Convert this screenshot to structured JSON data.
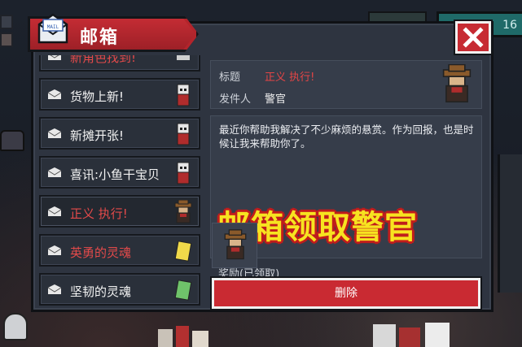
{
  "background": {
    "counter_text": "16"
  },
  "dialog": {
    "title": "邮箱",
    "mail_icon_text": "MAIL",
    "close_icon": "close-icon",
    "accent_color": "#c72b33"
  },
  "mail_list": {
    "items": [
      {
        "label": "新角色找到!",
        "color": "red",
        "thumb": "raccoon-icon"
      },
      {
        "label": "货物上新!",
        "color": "white",
        "thumb": "cat-merchant-icon"
      },
      {
        "label": "新摊开张!",
        "color": "white",
        "thumb": "cat-merchant-icon"
      },
      {
        "label": "喜讯:小鱼干宝贝",
        "color": "white",
        "thumb": "cat-merchant-icon"
      },
      {
        "label": "正义 执行!",
        "color": "red",
        "thumb": "officer-icon",
        "selected": true
      },
      {
        "label": "英勇的灵魂",
        "color": "red",
        "thumb": "yellow-card-icon"
      },
      {
        "label": "坚韧的灵魂",
        "color": "white",
        "thumb": "green-card-icon"
      }
    ]
  },
  "detail": {
    "title_label": "标题",
    "title_value": "正义 执行!",
    "sender_label": "发件人",
    "sender_value": "警官",
    "body": "最近你帮助我解决了不少麻烦的悬赏。作为回报，也是时候让我来帮助你了。",
    "overlay_caption": "邮箱领取警官",
    "reward_label": "奖励(已领取)",
    "delete_label": "删除"
  }
}
